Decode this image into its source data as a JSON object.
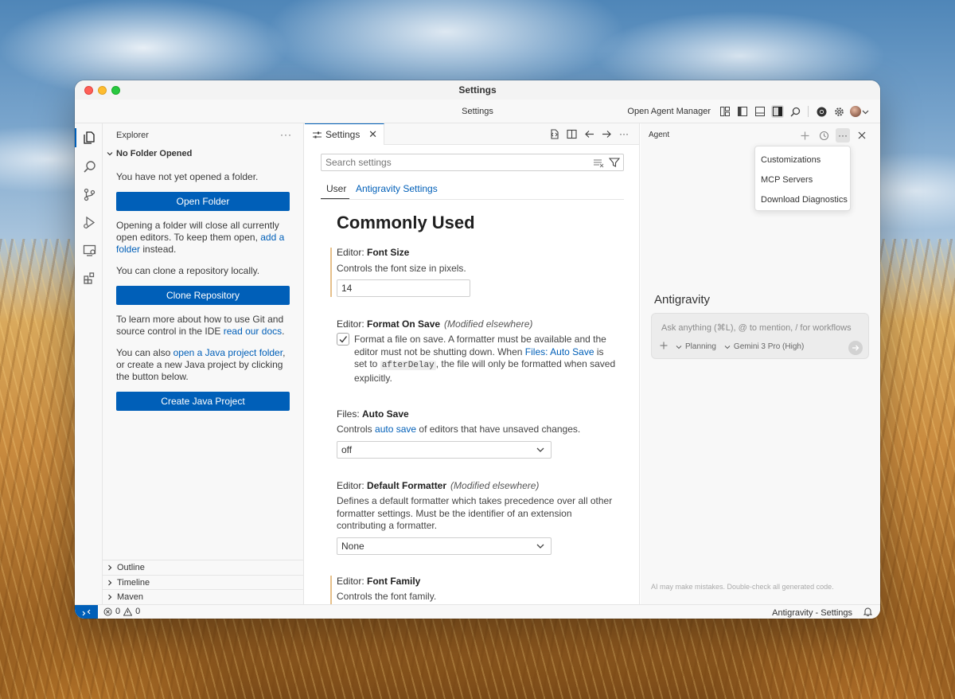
{
  "window": {
    "title": "Settings"
  },
  "titlebar": {
    "center": "Settings",
    "agent_manager": "Open Agent Manager",
    "icons": [
      "layout-icon",
      "toggle-primary-sidebar-icon",
      "toggle-panel-icon",
      "toggle-secondary-sidebar-icon",
      "search-icon",
      "chrome-icon",
      "gear-icon",
      "avatar"
    ]
  },
  "activitybar": {
    "items": [
      "explorer-icon",
      "search-icon",
      "source-control-icon",
      "run-debug-icon",
      "remote-explorer-icon",
      "extensions-icon"
    ]
  },
  "sidebar": {
    "title": "Explorer",
    "section": "No Folder Opened",
    "no_folder_text": "You have not yet opened a folder.",
    "open_folder_button": "Open Folder",
    "close_editors_text_1": "Opening a folder will close all currently open editors. To keep them open, ",
    "close_editors_link": "add a folder",
    "close_editors_text_2": " instead.",
    "clone_text": "You can clone a repository locally.",
    "clone_button": "Clone Repository",
    "git_text_1": "To learn more about how to use Git and source control in the IDE ",
    "git_link": "read our docs",
    "git_text_2": ".",
    "java_text_1": "You can also ",
    "java_link": "open a Java project folder",
    "java_text_2": ", or create a new Java project by clicking the button below.",
    "java_button": "Create Java Project",
    "collapsed_sections": [
      "Outline",
      "Timeline",
      "Maven"
    ]
  },
  "editor": {
    "tab_label": "Settings",
    "search_placeholder": "Search settings",
    "tabs": {
      "user": "User",
      "antigravity": "Antigravity Settings"
    },
    "section_title": "Commonly Used",
    "settings": {
      "font_size": {
        "category": "Editor: ",
        "name": "Font Size",
        "description": "Controls the font size in pixels.",
        "value": "14"
      },
      "format_on_save": {
        "category": "Editor: ",
        "name": "Format On Save",
        "modified": "(Modified elsewhere)",
        "desc_1": "Format a file on save. A formatter must be available and the editor must not be shutting down. When ",
        "desc_link": "Files: Auto Save",
        "desc_2": " is set to ",
        "desc_code": "afterDelay",
        "desc_3": ", the file will only be formatted when saved explicitly.",
        "checked": true
      },
      "auto_save": {
        "category": "Files: ",
        "name": "Auto Save",
        "desc_1": "Controls ",
        "desc_link": "auto save",
        "desc_2": " of editors that have unsaved changes.",
        "value": "off"
      },
      "default_formatter": {
        "category": "Editor: ",
        "name": "Default Formatter",
        "modified": "(Modified elsewhere)",
        "description": "Defines a default formatter which takes precedence over all other formatter settings. Must be the identifier of an extension contributing a formatter.",
        "value": "None"
      },
      "font_family": {
        "category": "Editor: ",
        "name": "Font Family",
        "description": "Controls the font family."
      }
    }
  },
  "agent": {
    "title": "Agent",
    "menu": [
      "Customizations",
      "MCP Servers",
      "Download Diagnostics"
    ],
    "brand": "Antigravity",
    "input_placeholder": "Ask anything (⌘L), @ to mention, / for workflows",
    "mode": "Planning",
    "model": "Gemini 3 Pro (High)",
    "disclaimer": "AI may make mistakes. Double-check all generated code."
  },
  "statusbar": {
    "errors": "0",
    "warnings": "0",
    "right_text": "Antigravity - Settings"
  },
  "colors": {
    "accent": "#005fb8",
    "modified_bar": "#e6c08b"
  }
}
